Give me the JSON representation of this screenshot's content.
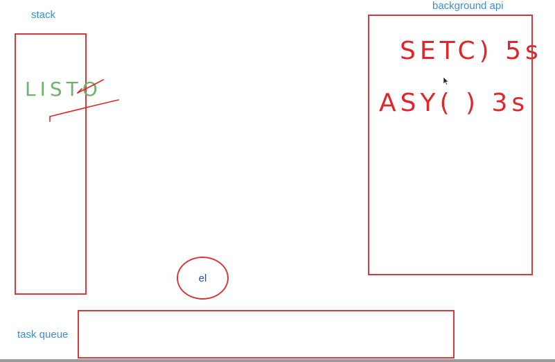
{
  "labels": {
    "stack": "stack",
    "background_api": "background api",
    "task_queue": "task queue",
    "event_loop": "el"
  },
  "handwriting": {
    "stack_entry": "LISTO",
    "bg_entry_1": "SETC) 5s",
    "bg_entry_2": "ASY( ) 3s"
  },
  "colors": {
    "box_stroke": "#d9383a",
    "label_blue": "#3b8fd9",
    "ink_green": "#6fb36f",
    "ink_red": "#e0262a"
  }
}
